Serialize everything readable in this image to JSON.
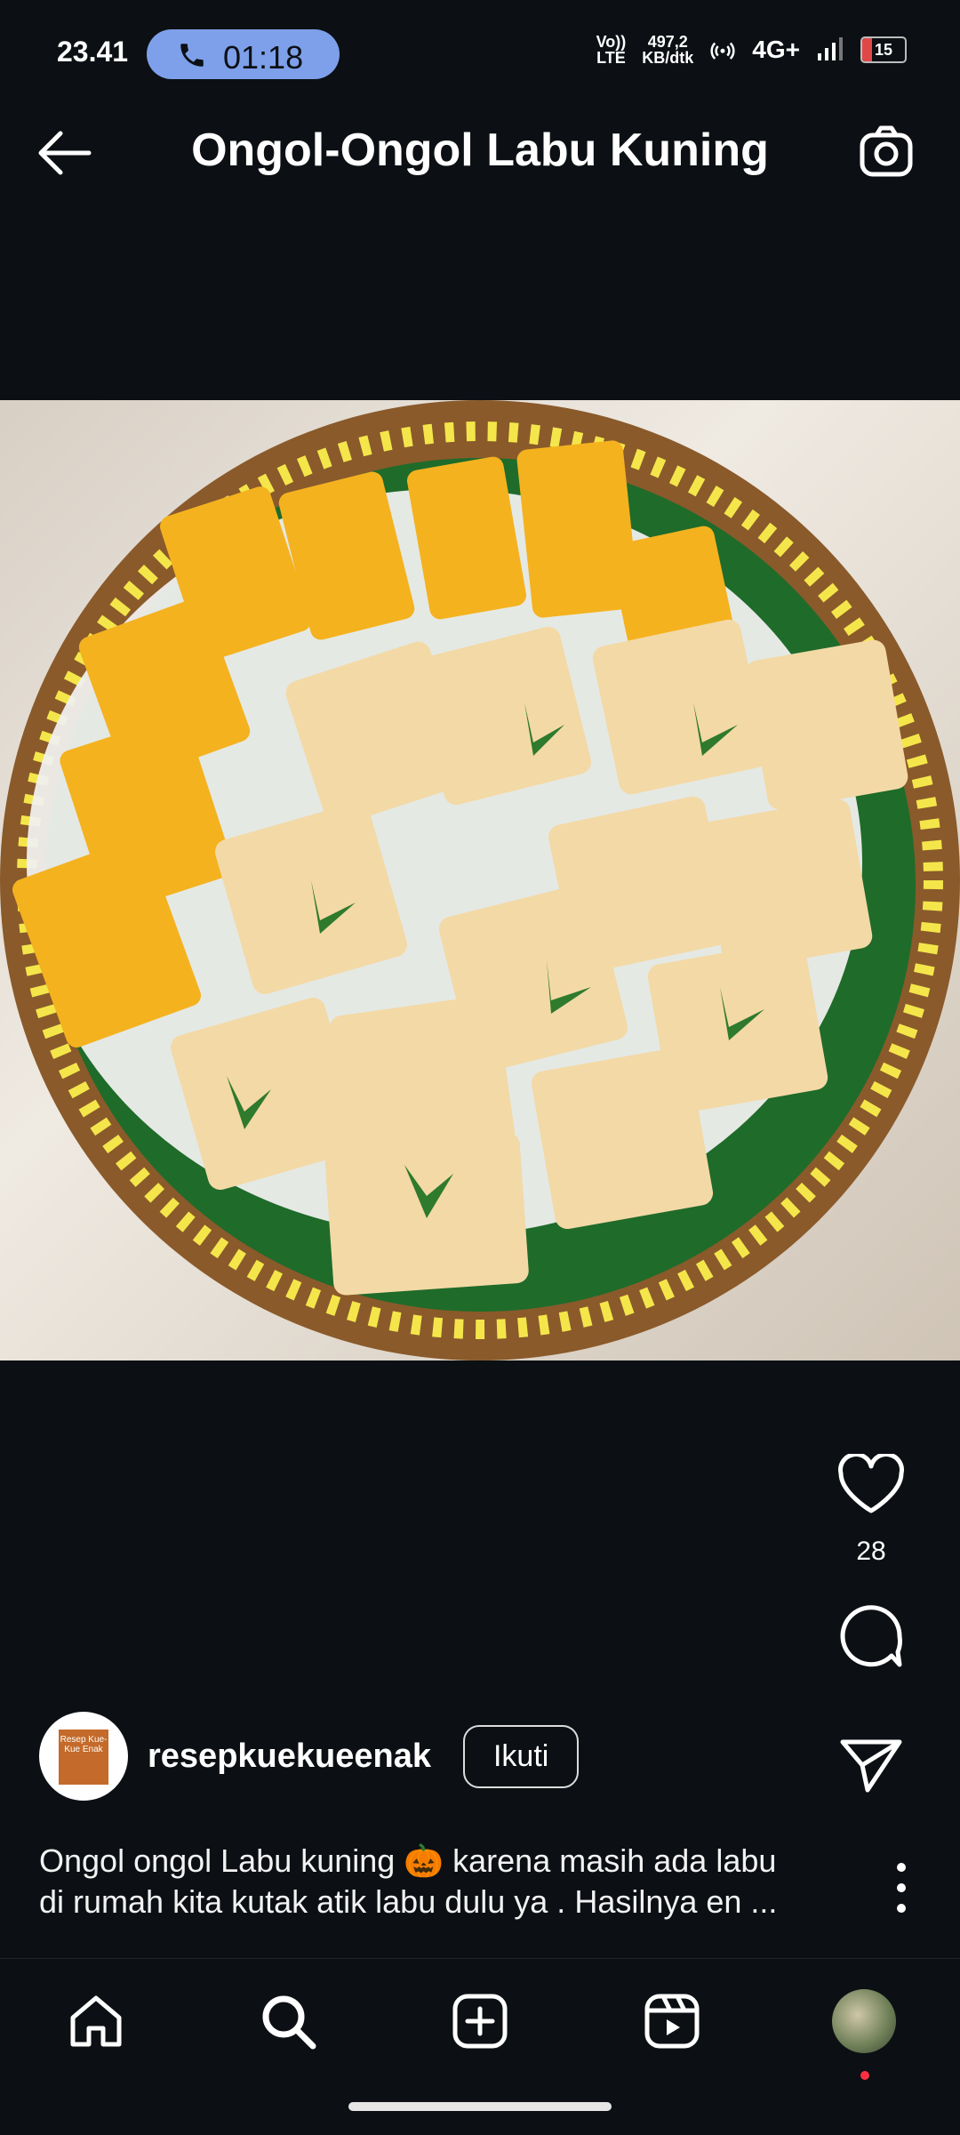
{
  "status_bar": {
    "time": "23.41",
    "call_time": "01:18",
    "volte_line1": "Vo))",
    "volte_line2": "LTE",
    "speed_line1": "497,2",
    "speed_line2": "KB/dtk",
    "network": "4G+",
    "battery": "15"
  },
  "header": {
    "title": "Ongol-Ongol Labu Kuning"
  },
  "post": {
    "likes": "28",
    "username": "resepkuekueenak",
    "follow_label": "Ikuti",
    "avatar_text": "Resep Kue-Kue Enak",
    "caption_line1": "Ongol ongol Labu kuning 🎃 karena masih ada labu",
    "caption_line2": "di rumah kita kutak atik labu dulu ya . Hasilnya en ..."
  },
  "colors": {
    "background": "#0c1014",
    "call_pill": "#7ea0ea",
    "battery_low": "#e04848",
    "notification_dot": "#ff3040"
  },
  "icons": [
    "back-arrow-icon",
    "camera-icon",
    "heart-icon",
    "comment-icon",
    "share-icon",
    "more-icon",
    "home-icon",
    "search-icon",
    "create-icon",
    "reels-icon"
  ]
}
